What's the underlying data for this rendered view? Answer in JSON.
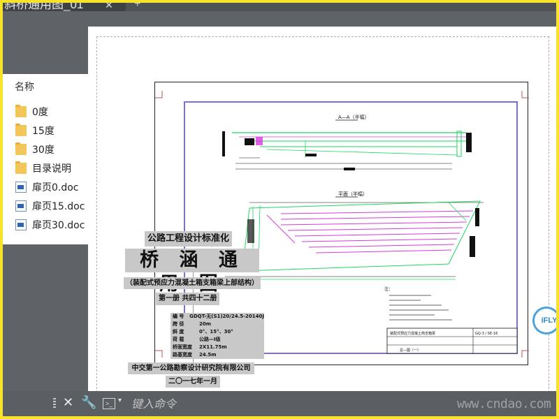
{
  "window": {
    "tab_title": "斜桥通用图_01",
    "tab_close_glyph": "✕",
    "tab_add_glyph": "+"
  },
  "file_panel": {
    "header": "名称",
    "items": [
      {
        "label": "0度",
        "icon": "folder-icon"
      },
      {
        "label": "15度",
        "icon": "folder-icon"
      },
      {
        "label": "30度",
        "icon": "folder-icon"
      },
      {
        "label": "目录说明",
        "icon": "folder-icon"
      },
      {
        "label": "扉页0.doc",
        "icon": "word-doc-icon"
      },
      {
        "label": "扉页15.doc",
        "icon": "word-doc-icon"
      },
      {
        "label": "扉页30.doc",
        "icon": "word-doc-icon"
      }
    ]
  },
  "drawing": {
    "section_title": "A—A（半幅）",
    "plan_title": "平面（半幅）",
    "notes_head": "注：",
    "titleblock_name": "装配式预应力混凝土简支箱梁",
    "titleblock_sheet": "总—图（一）",
    "titleblock_code": "GQ-3 / SE-16",
    "colors": {
      "frame_blue": "#7b6fe0",
      "green": "#1ed760",
      "magenta": "#d63bdc",
      "black": "#111111"
    }
  },
  "cover": {
    "title": "公路工程设计标准化",
    "big_title": "桥 涵 通 用 图",
    "subtitle": "（装配式预应力混凝土箱支箱梁上部结构）",
    "volume": "第一册  共四十二册",
    "specs": [
      {
        "k": "编    号",
        "v": "GDQT-无(S1)20/24.5-20140J"
      },
      {
        "k": "跨    径",
        "v": "20m"
      },
      {
        "k": "斜    度",
        "v": "0°、15°、30°"
      },
      {
        "k": "荷    载",
        "v": "公路—I级"
      },
      {
        "k": "桥面宽度",
        "v": "2X11.75m"
      },
      {
        "k": "路基宽度",
        "v": "24.5m"
      }
    ],
    "organization": "中交第一公路勘察设计研究院有限公司",
    "date": "二〇一七年一月"
  },
  "command_bar": {
    "placeholder": "键入命令",
    "close_glyph": "✕",
    "settings_glyph": "🔧",
    "prompt_glyph": ">_",
    "caret_glyph": "▾"
  },
  "watermark": "www.cndao.com",
  "badge": "iFLY"
}
